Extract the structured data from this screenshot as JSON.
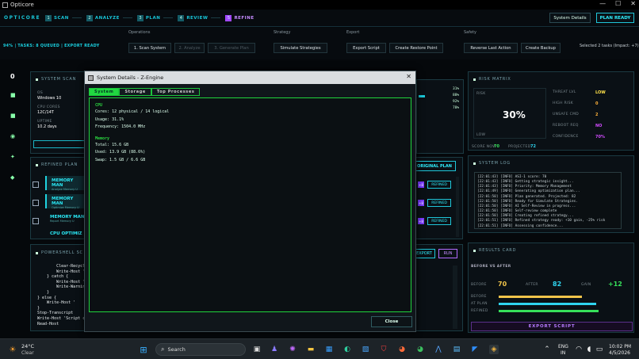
{
  "window": {
    "title": "Opticore",
    "min": "—",
    "max": "☐",
    "close": "✕"
  },
  "nav": {
    "brand": "OPTICORE",
    "steps": [
      {
        "num": "1",
        "label": "SCAN"
      },
      {
        "num": "2",
        "label": "ANALYZE"
      },
      {
        "num": "3",
        "label": "PLAN"
      },
      {
        "num": "4",
        "label": "REVIEW"
      },
      {
        "num": "5",
        "label": "REFINE"
      }
    ],
    "system_details": "System Details",
    "plan_ready": "PLAN READY"
  },
  "toolbar": {
    "status": "94% | TASKS: 8 QUEUED | EXPORT READY",
    "groups": {
      "operations": "Operations",
      "strategy": "Strategy",
      "export": "Export",
      "safety": "Safety"
    },
    "buttons": {
      "scan": "1. Scan System",
      "analyze": "2. Analyze",
      "generate": "3. Generate Plan",
      "simulate": "Simulate Strategies",
      "export": "Export Script",
      "restore": "Create Restore Point",
      "reverse": "Reverse Last Action",
      "backup": "Create Backup"
    },
    "selected": "Selected 2 tasks (Impact: +7)"
  },
  "left": {
    "count": "0"
  },
  "scan": {
    "title": "SYSTEM SCAN",
    "os_label": "OS",
    "os": "Windows 10",
    "cpu_label": "CPU CORES",
    "cpu": "12C/14T",
    "uptime_label": "UPTIME",
    "uptime": "10.2 days"
  },
  "mid_percents": [
    "31%",
    "88%",
    "92%",
    "78%"
  ],
  "plan": {
    "title": "REFINED PLAN",
    "items": [
      {
        "name": "MEMORY MAN",
        "sub": "Analyze Memory U"
      },
      {
        "name": "MEMORY MAN",
        "sub": "Optimize Memory U"
      },
      {
        "name": "MEMORY MAN",
        "sub": "Report Memory U"
      },
      {
        "name": "CPU OPTIMIZ",
        "sub": ""
      }
    ],
    "original_plan": "ORIGINAL PLAN",
    "refined": "REFINED",
    "badge": "+8"
  },
  "ps": {
    "title": "POWERSHELL SC",
    "export": "EXPORT",
    "run": "RUN",
    "lines": [
      "        Clear-Recycl",
      "        Write-Host '",
      "    } catch {",
      "        Write-Host '",
      "        Write-Warnin",
      "    }",
      "} else {",
      "    Write-Host '",
      "}",
      "",
      "Stop-Transcript",
      "Write-Host 'Script c",
      "Read-Host"
    ]
  },
  "dialog": {
    "title": "System Details - Z-Engine",
    "close_x": "✕",
    "tabs": [
      "System",
      "Storage",
      "Top Processes"
    ],
    "cpu_head": "CPU",
    "cpu_lines": [
      "Cores:  12 physical / 14 logical",
      "Usage:  31.1%",
      "Frequency:  1504.0 MHz"
    ],
    "mem_head": "Memory",
    "mem_lines": [
      "Total:  15.6 GB",
      "Used:  13.9 GB (88.6%)",
      "Swap:  1.5 GB / 6.6 GB"
    ],
    "close_button": "Close"
  },
  "risk": {
    "title": "RISK MATRIX",
    "risk_label": "RISK",
    "low_label": "LOW",
    "big": "30%",
    "threat_label": "THREAT LVL",
    "threat": "LOW",
    "high_label": "HIGH RISK",
    "high": "0",
    "unsafe_label": "UNSAFE CMD",
    "unsafe": "2",
    "reboot_label": "REBOOT REQ",
    "reboot": "NO",
    "conf_label": "CONFIDENCE",
    "conf": "70%",
    "score_label": "SCORE NOW",
    "score": "70",
    "proj_label": "PROJECTED",
    "proj": "72"
  },
  "log": {
    "title": "SYSTEM LOG",
    "lines": [
      "[22:01:43] [INFO] ASI-1 score: 70",
      "[22:01:43] [INFO] Getting strategic insight...",
      "[22:01:43] [INFO] Priority: Memory Management",
      "[22:01:49] [INFO] Generating optimization plan...",
      "[22:01:50] [INFO] Plan generated. Projected: 82",
      "[22:01:50] [INFO] Ready for Simulate Strategies.",
      "[22:01:50] [INFO] AI Self-Review in progress...",
      "[22:01:50] [INFO] Self-review complete",
      "[22:01:50] [INFO] Creating refined strategy...",
      "[22:01:51] [INFO] Refined strategy ready: +10 gain, -25% risk",
      "[22:01:51] [INFO] Assessing confidence..."
    ]
  },
  "results": {
    "title": "RESULTS CARD",
    "bva": "BEFORE VS AFTER",
    "before_label": "BEFORE",
    "before": "70",
    "after_label": "AFTER",
    "after": "82",
    "gain_label": "GAIN",
    "gain": "+12",
    "bars": [
      {
        "label": "BEFORE",
        "value": 70,
        "color": "#f0c44a"
      },
      {
        "label": "AT PLAN",
        "value": 82,
        "color": "#2fd4ef"
      },
      {
        "label": "REFINED",
        "value": 84,
        "color": "#36e05a"
      }
    ],
    "export": "EXPORT SCRIPT"
  },
  "taskbar": {
    "temp": "24°C",
    "weather": "Clear",
    "search": "Search",
    "lang1": "ENG",
    "lang2": "IN",
    "time": "10:02 PM",
    "date": "4/5/2026"
  }
}
